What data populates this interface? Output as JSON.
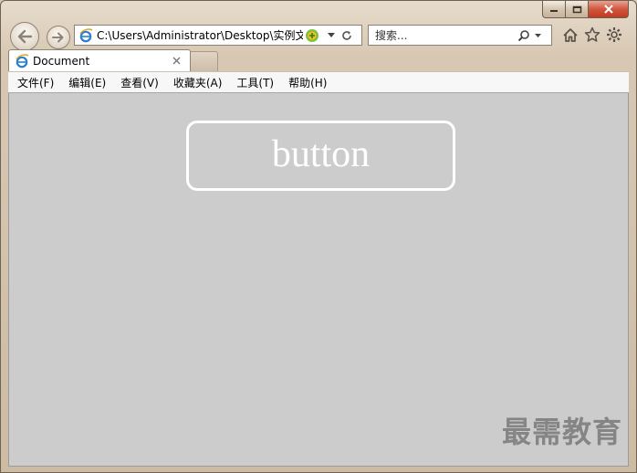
{
  "window": {
    "caption_buttons": [
      "minimize-icon",
      "maximize-icon",
      "close-icon"
    ]
  },
  "navigation": {
    "address": "C:\\Users\\Administrator\\Desktop\\实例文",
    "search_placeholder": "搜索..."
  },
  "tab": {
    "title": "Document"
  },
  "menu": {
    "items": [
      "文件(F)",
      "编辑(E)",
      "查看(V)",
      "收藏夹(A)",
      "工具(T)",
      "帮助(H)"
    ]
  },
  "page": {
    "button_label": "button",
    "background_color": "#cccccc",
    "button_color": "#ffffff"
  },
  "watermark": {
    "text": "最需教育"
  },
  "icons": {
    "back": "back-arrow-icon",
    "forward": "forward-arrow-icon",
    "page": "ie-page-icon",
    "compat": "compatibility-view-icon",
    "refresh": "refresh-icon",
    "search": "search-icon",
    "home": "home-icon",
    "favorites": "star-icon",
    "settings": "gear-icon"
  }
}
